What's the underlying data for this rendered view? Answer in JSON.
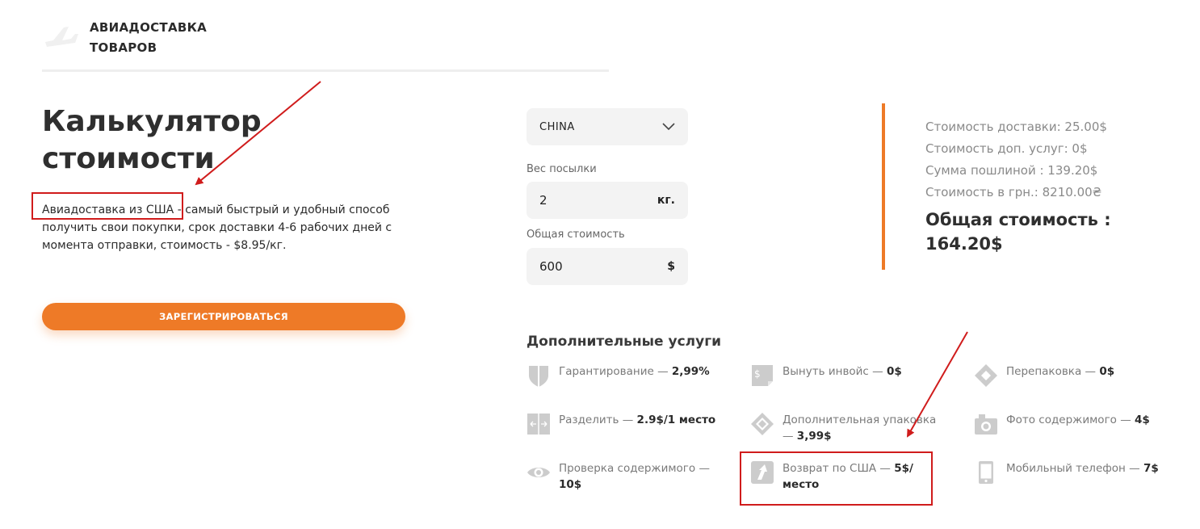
{
  "header": {
    "brand_line1": "АВИАДОСТАВКА",
    "brand_line2": "ТОВАРОВ",
    "icon": "airplane-icon"
  },
  "hero": {
    "title_line1": "Калькулятор",
    "title_line2": "стоимости",
    "description_highlight": "Авиадоставка из США",
    "description_rest": " - самый быстрый и удобный способ получить свои покупки, срок доставки 4-6 рабочих дней с момента отправки, стоимость - $8.95/кг.",
    "register_button": "ЗАРЕГИСТРИРОВАТЬСЯ"
  },
  "form": {
    "country": {
      "selected": "CHINA",
      "icon": "chevron-down-icon"
    },
    "weight": {
      "label": "Вес посылки",
      "value": "2",
      "unit": "кг."
    },
    "total_cost": {
      "label": "Общая стоимость",
      "value": "600",
      "unit": "$"
    }
  },
  "summary": {
    "delivery_cost": "Стоимость доставки: 25.00$",
    "extra_services_cost": "Стоимость доп. услуг: 0$",
    "duty_sum": "Сумма пошлиной : 139.20$",
    "uah_cost": "Стоимость в грн.: 8210.00₴",
    "total_line1": "Общая стоимость :",
    "total_line2": "164.20$"
  },
  "services": {
    "title": "Дополнительные услуги",
    "items": [
      {
        "text": "Гарантирование — ",
        "price": "2,99%",
        "icon": "shield-icon"
      },
      {
        "text": "Вынуть инвойс — ",
        "price": "0$",
        "icon": "invoice-icon"
      },
      {
        "text": "Перепаковка — ",
        "price": "0$",
        "icon": "repack-icon"
      },
      {
        "text": "Разделить — ",
        "price": "2.9$/1 место",
        "icon": "split-icon"
      },
      {
        "text": "Дополнительная упаковка — ",
        "price": "3,99$",
        "icon": "package-icon"
      },
      {
        "text": "Фото содержимого — ",
        "price": "4$",
        "icon": "camera-icon"
      },
      {
        "text": "Проверка содержимого — ",
        "price": "10$",
        "icon": "eye-icon"
      },
      {
        "text": "Возврат по США — ",
        "price": "5$/место",
        "icon": "return-icon"
      },
      {
        "text": "Мобильный телефон — ",
        "price": "7$",
        "icon": "phone-icon"
      }
    ]
  },
  "colors": {
    "accent": "#ee7a27",
    "annotation": "#d01c1c",
    "icon_gray": "#cccccc"
  }
}
